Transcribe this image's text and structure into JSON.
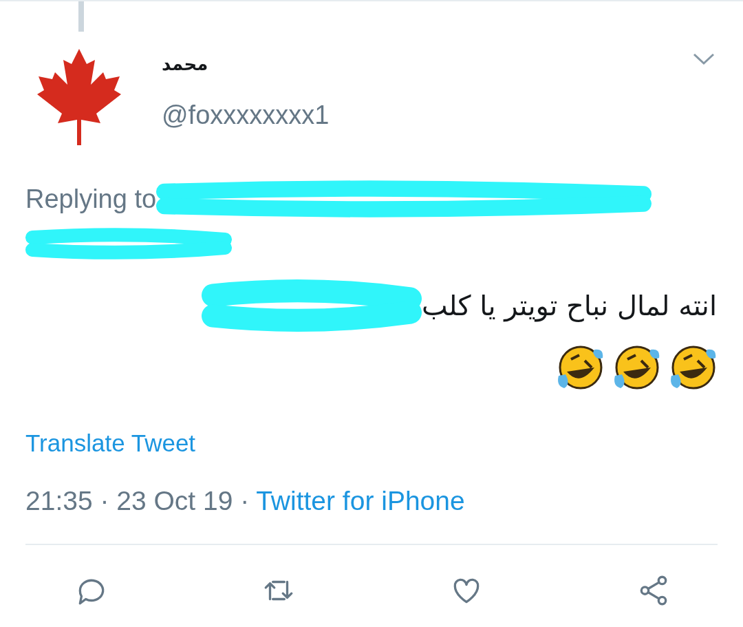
{
  "tweet": {
    "author_name": "محمد",
    "handle": "@foxxxxxxxx1",
    "replying_to": "Replying to",
    "text": "انته لمال نباح تويتر يا كلب",
    "translate": "Translate Tweet",
    "timestamp": "21:35 · 23 Oct 19 ·",
    "source": "Twitter for iPhone"
  },
  "actions": [
    {
      "kind": "reply"
    },
    {
      "kind": "retweet"
    },
    {
      "kind": "like"
    },
    {
      "kind": "share"
    }
  ]
}
